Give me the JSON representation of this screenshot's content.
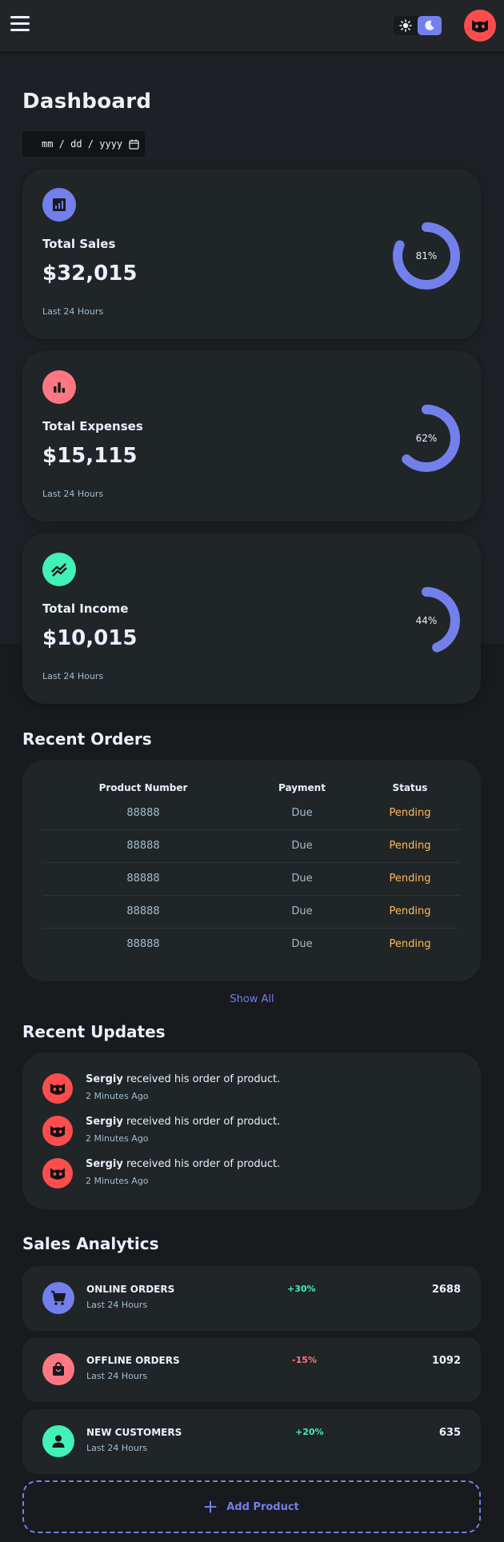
{
  "topbar": {
    "menu_icon": "menu-icon",
    "theme_light_icon": "sun-icon",
    "theme_dark_icon": "moon-icon",
    "profile_icon": "profile-avatar"
  },
  "page": {
    "title": "Dashboard",
    "date_placeholder": "mm / dd / yyyy"
  },
  "insights": [
    {
      "label": "Total Sales",
      "value": "$32,015",
      "sub": "Last 24 Hours",
      "percent_text": "81%",
      "percent": 81,
      "icon": "analytics-icon",
      "icon_color": "#7380ec"
    },
    {
      "label": "Total Expenses",
      "value": "$15,115",
      "sub": "Last 24 Hours",
      "percent_text": "62%",
      "percent": 62,
      "icon": "bar-chart-icon",
      "icon_color": "#ff7782"
    },
    {
      "label": "Total Income",
      "value": "$10,015",
      "sub": "Last 24 Hours",
      "percent_text": "44%",
      "percent": 44,
      "icon": "stocks-icon",
      "icon_color": "#41f1b6"
    }
  ],
  "orders": {
    "title": "Recent Orders",
    "headers": [
      "Product Number",
      "Payment",
      "Status"
    ],
    "rows": [
      [
        "88888",
        "Due",
        "Pending"
      ],
      [
        "88888",
        "Due",
        "Pending"
      ],
      [
        "88888",
        "Due",
        "Pending"
      ],
      [
        "88888",
        "Due",
        "Pending"
      ],
      [
        "88888",
        "Due",
        "Pending"
      ]
    ],
    "show_all": "Show All"
  },
  "updates": {
    "title": "Recent Updates",
    "items": [
      {
        "name": "Sergiy",
        "text": " received his order of product.",
        "time": "2 Minutes Ago"
      },
      {
        "name": "Sergiy",
        "text": " received his order of product.",
        "time": "2 Minutes Ago"
      },
      {
        "name": "Sergiy",
        "text": " received his order of product.",
        "time": "2 Minutes Ago"
      }
    ]
  },
  "analytics": {
    "title": "Sales Analytics",
    "items": [
      {
        "name": "ONLINE ORDERS",
        "sub": "Last 24 Hours",
        "pct": "+30%",
        "count": "2688",
        "icon": "cart-icon",
        "icon_color": "#7380ec",
        "pct_color": "#41f1b6"
      },
      {
        "name": "OFFLINE ORDERS",
        "sub": "Last 24 Hours",
        "pct": "-15%",
        "count": "1092",
        "icon": "shopping-bag-icon",
        "icon_color": "#ff7782",
        "pct_color": "#ff7782"
      },
      {
        "name": "NEW CUSTOMERS",
        "sub": "Last 24 Hours",
        "pct": "+20%",
        "count": "635",
        "icon": "person-icon",
        "icon_color": "#41f1b6",
        "pct_color": "#41f1b6"
      }
    ],
    "add_product": "Add Product"
  }
}
